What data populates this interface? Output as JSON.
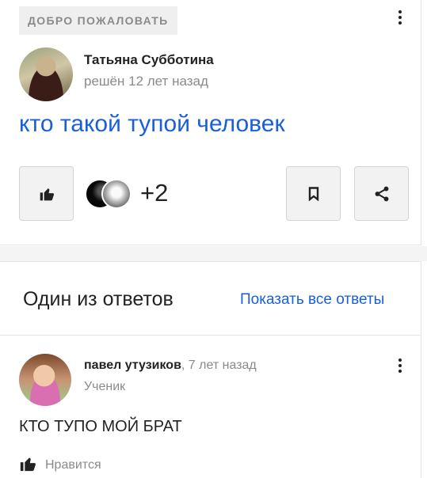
{
  "question": {
    "badge": "ДОБРО ПОЖАЛОВАТЬ",
    "author_name": "Татьяна Субботина",
    "status": "решён 12 лет назад",
    "title": "кто такой тупой человек",
    "likes_extra": "+2",
    "icons": {
      "menu": "more-vertical-icon",
      "like": "thumbs-up-icon",
      "bookmark": "bookmark-icon",
      "share": "share-icon"
    }
  },
  "answers": {
    "header": "Один из ответов",
    "show_all": "Показать все ответы",
    "items": [
      {
        "author": "павел утузиков",
        "time": ", 7 лет назад",
        "rank": "Ученик",
        "text": "КТО ТУПО МОЙ БРАТ",
        "like_label": "Нравится"
      }
    ]
  },
  "colors": {
    "accent": "#1a5fd6",
    "muted_text": "#8a8a8a",
    "badge_bg": "#efefef",
    "button_bg": "#f2f2f2"
  }
}
